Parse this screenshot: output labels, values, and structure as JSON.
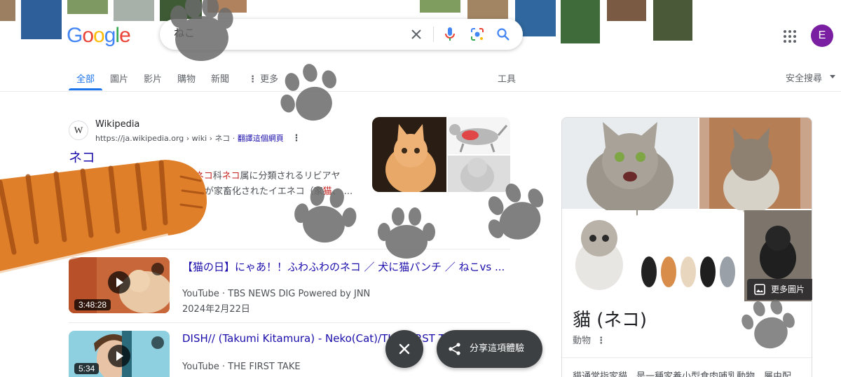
{
  "logo_letters": [
    "G",
    "o",
    "o",
    "g",
    "l",
    "e"
  ],
  "search": {
    "query": "ねこ"
  },
  "avatar_letter": "E",
  "tabs": [
    {
      "label": "全部"
    },
    {
      "label": "圖片"
    },
    {
      "label": "影片"
    },
    {
      "label": "購物"
    },
    {
      "label": "新聞"
    },
    {
      "label": "更多"
    }
  ],
  "tools_label": "工具",
  "safe_search_label": "安全搜尋",
  "result": {
    "favicon_letter": "W",
    "site": "Wikipedia",
    "breadcrumb": "https://ja.wikipedia.org › wiki › ネコ",
    "translate_label": "翻譯這個網頁",
    "title": "ネコ",
    "snippet_line1_a": "ネコ",
    "snippet_line1_b": "科",
    "snippet_line1_c": "ネコ",
    "snippet_line1_d": "属に分類されるリビアヤ",
    "snippet_line2_a": "が家畜化されたイエネコ（家",
    "snippet_line2_b": "猫",
    "snippet_line2_c": "、 ..."
  },
  "videos": [
    {
      "title": "【猫の日】にゃあ！！ふわふわのネコ ／ 犬に猫パンチ ／ ねこvs ...",
      "source": "YouTube · TBS NEWS DIG Powered by JNN",
      "date": "2024年2月22日",
      "duration": "3:48:28"
    },
    {
      "title": "DISH// (Takumi Kitamura) - Neko(Cat)/THE FIRST TAKE",
      "source": "YouTube · THE FIRST TAKE",
      "duration": "5:34"
    }
  ],
  "knowledge_panel": {
    "more_images_label": "更多圖片",
    "title": "貓 (ネコ)",
    "subtitle": "動物",
    "description": "貓通常指家貓，是一種家養小型食肉哺乳動物，屬由配"
  },
  "share_label": "分享這項體驗",
  "colors": {
    "link": "#1a0dab",
    "accent": "#1a73e8",
    "avatar": "#7b1fa2",
    "paw": "#6b6b6b",
    "cat_arm": "#e07f2a"
  }
}
